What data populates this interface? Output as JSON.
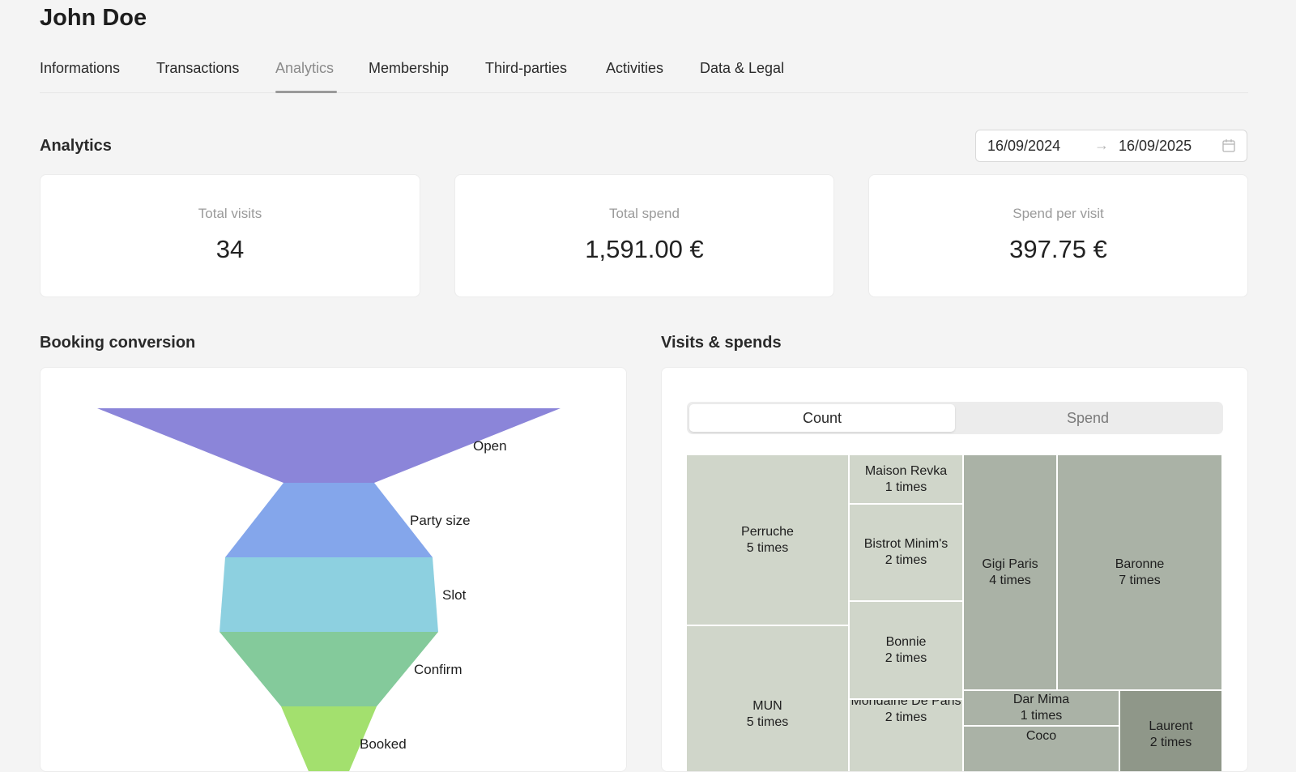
{
  "header": {
    "title": "John Doe"
  },
  "tabs": [
    {
      "label": "Informations",
      "active": false
    },
    {
      "label": "Transactions",
      "active": false
    },
    {
      "label": "Analytics",
      "active": true
    },
    {
      "label": "Membership",
      "active": false
    },
    {
      "label": "Third-parties",
      "active": false
    },
    {
      "label": "Activities",
      "active": false
    },
    {
      "label": "Data & Legal",
      "active": false
    }
  ],
  "analytics": {
    "title": "Analytics",
    "date_range": {
      "start": "16/09/2024",
      "arrow": "→",
      "end": "16/09/2025",
      "icon": "calendar-icon"
    },
    "kpis": [
      {
        "label": "Total visits",
        "value": "34"
      },
      {
        "label": "Total spend",
        "value": "1,591.00 €"
      },
      {
        "label": "Spend per visit",
        "value": "397.75 €"
      }
    ]
  },
  "booking": {
    "title": "Booking conversion",
    "chart_data": {
      "type": "funnel",
      "stages": [
        {
          "name": "Open",
          "color": "#8b85d9"
        },
        {
          "name": "Party size",
          "color": "#84a6eb"
        },
        {
          "name": "Slot",
          "color": "#8dd0e0"
        },
        {
          "name": "Confirm",
          "color": "#84ca9b"
        },
        {
          "name": "Booked",
          "color": "#a3e06e"
        }
      ]
    }
  },
  "visits": {
    "title": "Visits & spends",
    "toggle": {
      "count_label": "Count",
      "spend_label": "Spend",
      "active": "Count"
    },
    "chart_data": {
      "type": "treemap",
      "items": [
        {
          "name": "Perruche",
          "label": "5 times",
          "value": 5
        },
        {
          "name": "MUN",
          "label": "5 times",
          "value": 5
        },
        {
          "name": "Maison Revka",
          "label": "1 times",
          "value": 1
        },
        {
          "name": "Bistrot Minim's",
          "label": "2 times",
          "value": 2
        },
        {
          "name": "Bonnie",
          "label": "2 times",
          "value": 2
        },
        {
          "name": "Mondaine De Paris",
          "label": "2 times",
          "value": 2
        },
        {
          "name": "Gigi Paris",
          "label": "4 times",
          "value": 4
        },
        {
          "name": "Baronne",
          "label": "7 times",
          "value": 7
        },
        {
          "name": "Dar Mima",
          "label": "1 times",
          "value": 1
        },
        {
          "name": "Coco",
          "label": "",
          "value": 1
        },
        {
          "name": "Laurent",
          "label": "2 times",
          "value": 2
        }
      ],
      "colors": {
        "light": "#d0d6ca",
        "mid": "#aab2a6",
        "dark": "#8f9789"
      }
    }
  }
}
